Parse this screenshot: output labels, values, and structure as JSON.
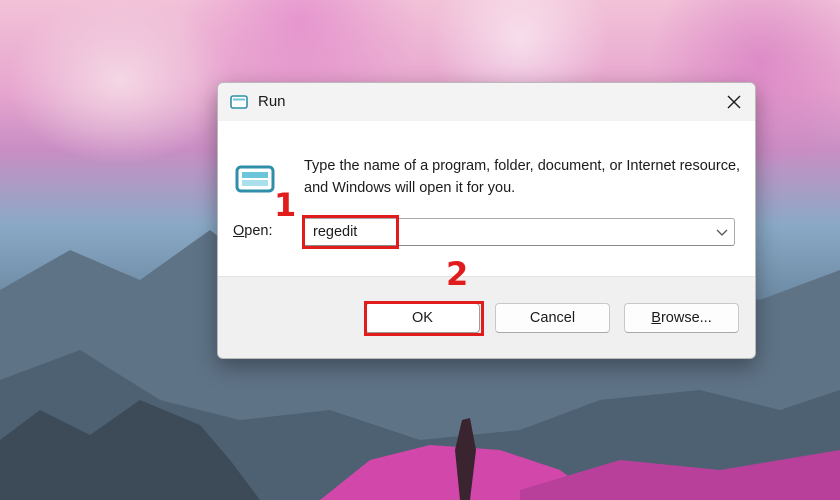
{
  "dialog": {
    "title": "Run",
    "close_icon": "close-icon",
    "app_icon": "run-icon",
    "description": "Type the name of a program, folder, document, or Internet resource, and Windows will open it for you.",
    "open_label": "Open:",
    "open_value": "regedit",
    "dropdown_icon": "chevron-down-icon",
    "buttons": {
      "ok": "OK",
      "cancel": "Cancel",
      "browse": "Browse..."
    }
  },
  "annotations": {
    "step1": "1",
    "step2": "2",
    "highlight_color": "#e01c1c"
  }
}
